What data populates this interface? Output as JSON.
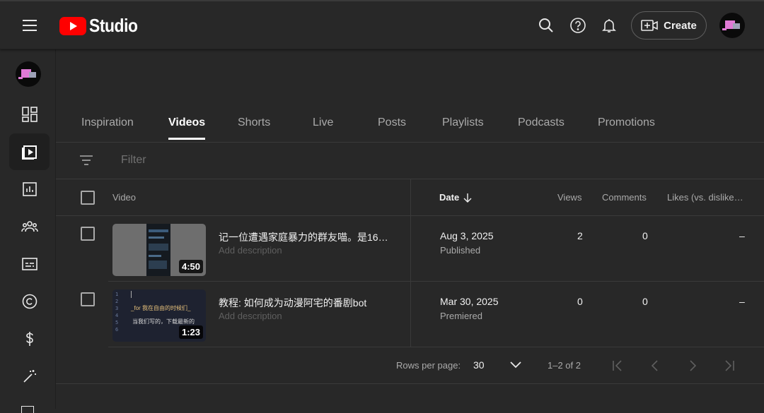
{
  "header": {
    "logo_text": "Studio",
    "create_label": "Create"
  },
  "tabs": [
    "Inspiration",
    "Videos",
    "Shorts",
    "Live",
    "Posts",
    "Playlists",
    "Podcasts",
    "Promotions"
  ],
  "active_tab": "Videos",
  "filter": {
    "placeholder": "Filter"
  },
  "table": {
    "columns": {
      "video": "Video",
      "date": "Date",
      "views": "Views",
      "comments": "Comments",
      "likes": "Likes (vs. dislike…"
    },
    "rows": [
      {
        "title": "记一位遭遇家庭暴力的群友喵。是16…",
        "description": "Add description",
        "duration": "4:50",
        "date": "Aug 3, 2025",
        "status": "Published",
        "views": "2",
        "comments": "0",
        "likes": "–"
      },
      {
        "title": "教程: 如何成为动漫阿宅的番剧bot",
        "description": "Add description",
        "duration": "1:23",
        "date": "Mar 30, 2025",
        "status": "Premiered",
        "views": "0",
        "comments": "0",
        "likes": "–"
      }
    ]
  },
  "pagination": {
    "rows_per_page_label": "Rows per page:",
    "rows_per_page": "30",
    "range": "1–2 of 2"
  },
  "thumb2_code": {
    "line1": "_for 我在自由的时候们_",
    "line2": "当我们写的，下载最新的"
  },
  "colors": {
    "brand_red": "#ff0000",
    "background": "#282828",
    "text": "#f1f1f1",
    "muted": "#aaaaaa"
  }
}
